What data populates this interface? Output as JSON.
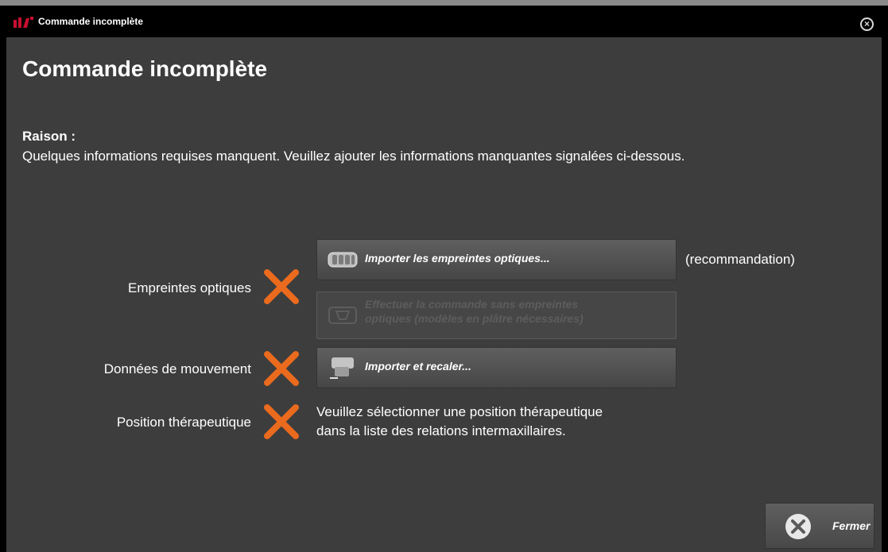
{
  "window": {
    "title": "Commande incomplète"
  },
  "dialog": {
    "heading": "Commande incomplète",
    "reason_label": "Raison :",
    "reason_text": "Quelques informations requises manquent. Veuillez ajouter les informations manquantes signalées ci-dessous."
  },
  "items": {
    "optical": {
      "label": "Empreintes optiques",
      "status_icon": "x-icon",
      "import_button": "Importer les empreintes optiques...",
      "recommendation": "(recommandation)",
      "skip_button_line1": "Effectuer la commande sans empreintes",
      "skip_button_line2": "optiques (modèles en plâtre nécessaires)"
    },
    "movement": {
      "label": "Données de mouvement",
      "status_icon": "x-icon",
      "import_button": "Importer et recaler..."
    },
    "therapeutic": {
      "label": "Position thérapeutique",
      "status_icon": "x-icon",
      "instruction_line1": "Veuillez sélectionner une position thérapeutique",
      "instruction_line2": "dans la liste des relations intermaxillaires."
    }
  },
  "footer": {
    "close_button": "Fermer"
  },
  "colors": {
    "accent_x": "#ea6a1e",
    "logo": "#c8102e",
    "background": "#3d3d3d"
  }
}
